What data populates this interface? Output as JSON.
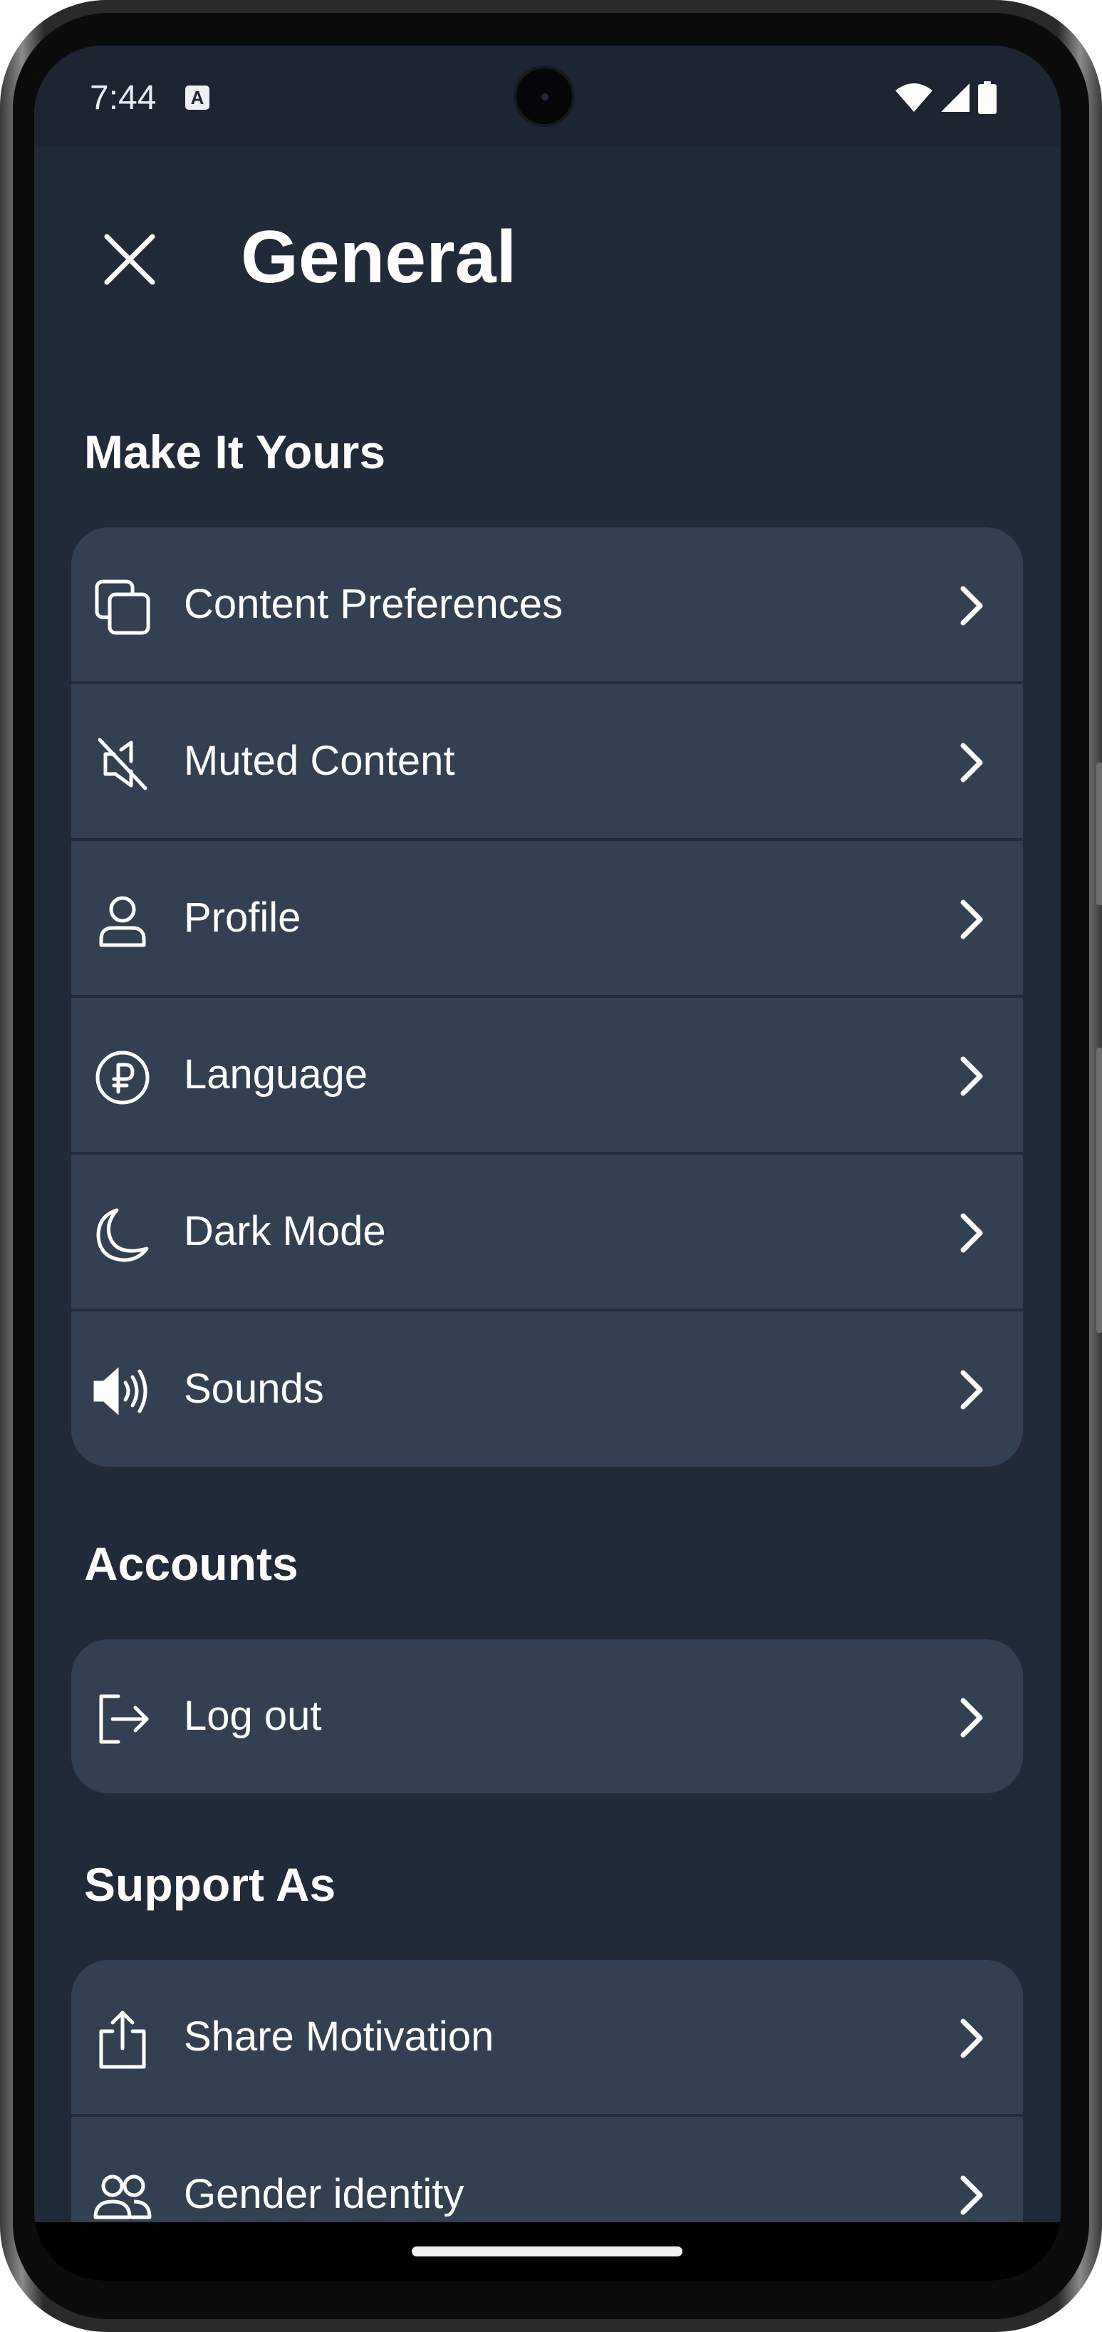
{
  "status_bar": {
    "time": "7:44",
    "notification_badge": "A",
    "icons": [
      "wifi-icon",
      "signal-icon",
      "battery-icon"
    ]
  },
  "header": {
    "title": "General",
    "close_icon": "close-icon"
  },
  "sections": [
    {
      "title": "Make It Yours",
      "items": [
        {
          "label": "Content Preferences",
          "icon": "copy-icon"
        },
        {
          "label": "Muted Content",
          "icon": "muted-speaker-icon"
        },
        {
          "label": "Profile",
          "icon": "person-icon"
        },
        {
          "label": "Language",
          "icon": "currency-icon"
        },
        {
          "label": "Dark Mode",
          "icon": "moon-icon"
        },
        {
          "label": "Sounds",
          "icon": "speaker-icon"
        }
      ]
    },
    {
      "title": "Accounts",
      "items": [
        {
          "label": "Log out",
          "icon": "logout-icon"
        }
      ]
    },
    {
      "title": "Support As",
      "items": [
        {
          "label": "Share Motivation",
          "icon": "share-icon"
        },
        {
          "label": "Gender identity",
          "icon": "people-icon"
        }
      ]
    }
  ],
  "colors": {
    "background": "#212a38",
    "card": "#334052",
    "text": "#ffffff"
  }
}
